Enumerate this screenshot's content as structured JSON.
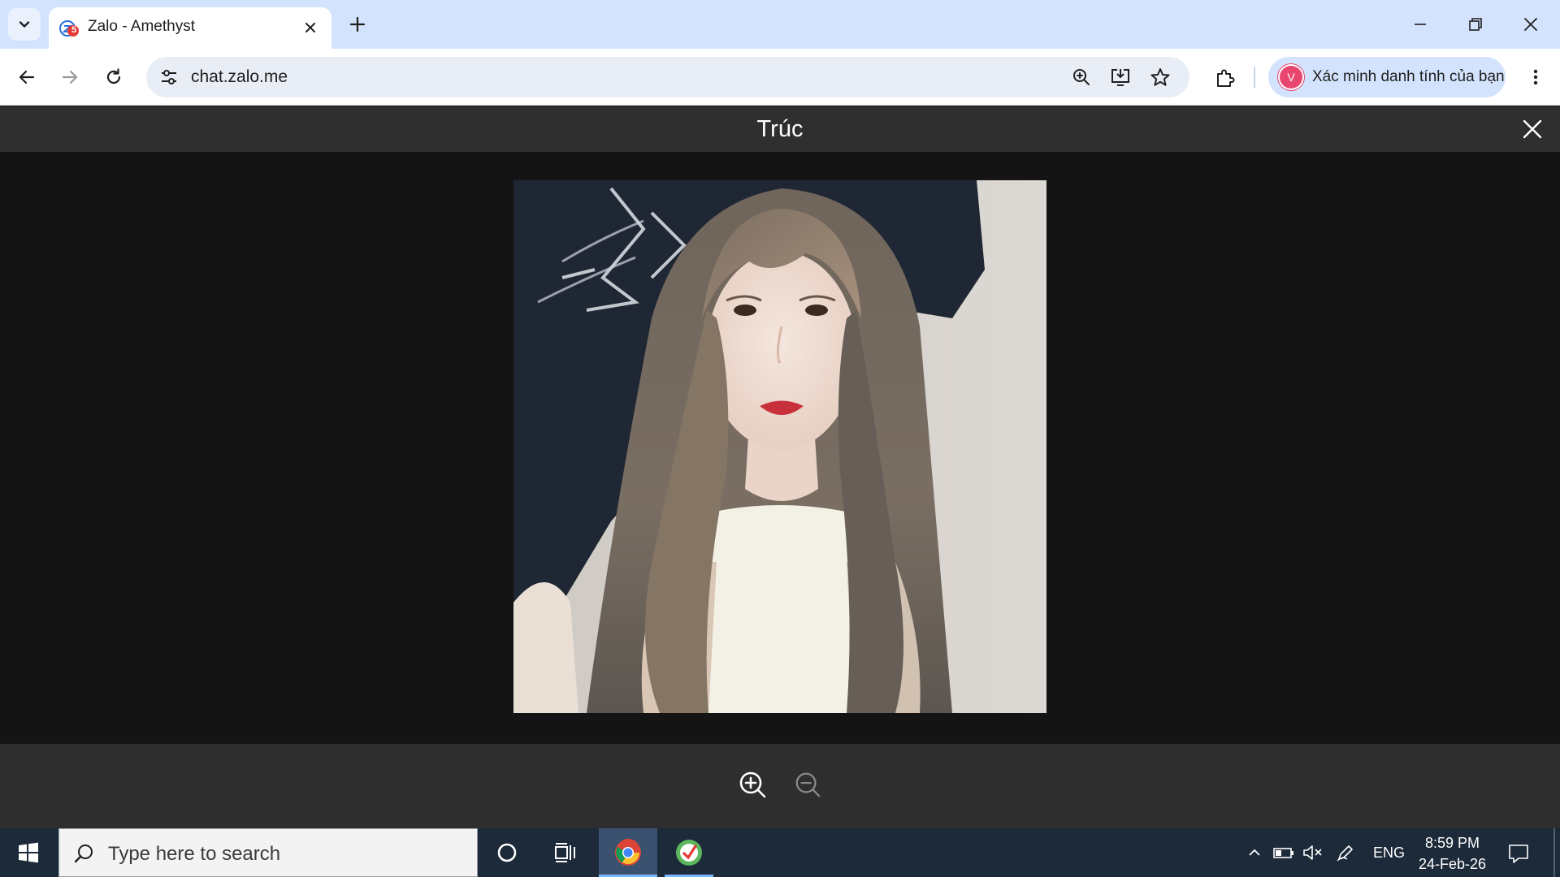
{
  "browser": {
    "tab_title": "Zalo - Amethyst",
    "favicon_badge": "5",
    "url": "chat.zalo.me",
    "profile_chip_label": "Xác minh danh tính của bạn",
    "profile_avatar_letter": "V"
  },
  "viewer": {
    "title": "Trúc",
    "photo_icon": "portrait-photo"
  },
  "taskbar": {
    "search_placeholder": "Type here to search",
    "language": "ENG",
    "time": "8:59 PM",
    "date": "24-Feb-26"
  },
  "colors": {
    "tabstrip": "#d3e3fd",
    "viewer_bg": "#141414",
    "viewer_bar": "#2f2f2f",
    "taskbar": "#1c2a3a",
    "zalo_red": "#d81b2e"
  }
}
